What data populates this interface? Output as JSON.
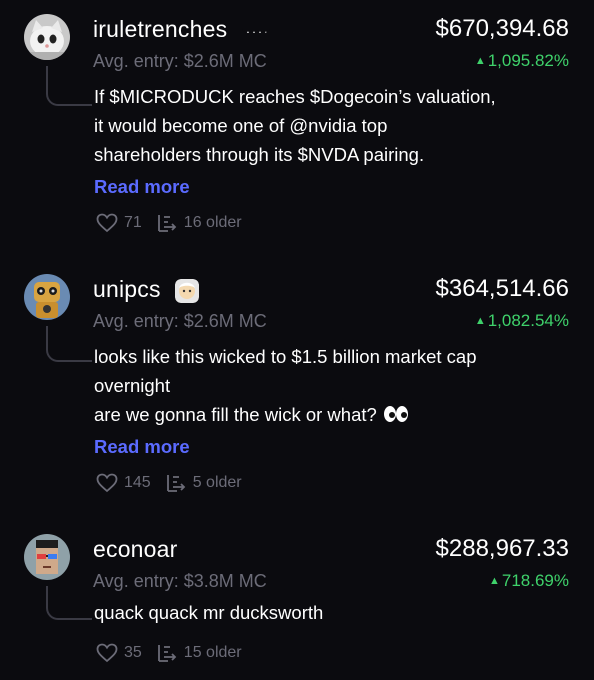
{
  "posts": [
    {
      "username": "iruletrenches",
      "value": "$670,394.68",
      "avg_entry": "Avg. entry: $2.6M MC",
      "change": "1,095.82%",
      "lines": [
        "If $MICRODUCK reaches $Dogecoin’s valuation,",
        "it would become one of @nvidia top",
        "shareholders through its $NVDA pairing."
      ],
      "read_more": "Read more",
      "likes": "71",
      "older": "16 older"
    },
    {
      "username": "unipcs",
      "value": "$364,514.66",
      "avg_entry": "Avg. entry: $2.6M MC",
      "change": "1,082.54%",
      "lines": [
        "looks like this wicked to $1.5 billion market cap",
        "overnight",
        "are we gonna fill the wick or what?"
      ],
      "read_more": "Read more",
      "likes": "145",
      "older": "5 older"
    },
    {
      "username": "econoar",
      "value": "$288,967.33",
      "avg_entry": "Avg. entry: $3.8M MC",
      "change": "718.69%",
      "lines": [
        "quack quack mr ducksworth"
      ],
      "likes": "35",
      "older": "15 older"
    }
  ],
  "colors": {
    "background": "#0b0b0f",
    "positive": "#3fd26b",
    "link": "#5b6bff",
    "muted": "#6c6c78"
  },
  "icons": {
    "like": "heart-icon",
    "older": "replies-icon",
    "up": "triangle-up-icon"
  },
  "glyphs": {
    "up": "▲"
  }
}
